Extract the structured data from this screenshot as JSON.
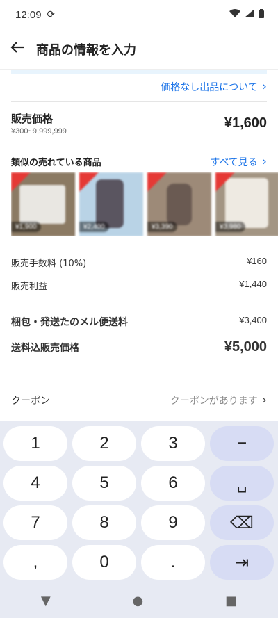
{
  "status": {
    "time": "12:09"
  },
  "header": {
    "title": "商品の情報を入力"
  },
  "links": {
    "no_price_listing": "価格なし出品について"
  },
  "price": {
    "label": "販売価格",
    "range": "¥300~9,999,999",
    "value": "¥1,600"
  },
  "similar": {
    "title": "類似の売れている商品",
    "see_all": "すべて見る",
    "items": [
      {
        "price": "¥1,900"
      },
      {
        "price": "¥2,400"
      },
      {
        "price": "¥3,390"
      },
      {
        "price": "¥3,980"
      }
    ]
  },
  "fees": {
    "commission_label": "販売手数料 (10%)",
    "commission_value": "¥160",
    "profit_label": "販売利益",
    "profit_value": "¥1,440",
    "shipping_label": "梱包・発送たのメル便送料",
    "shipping_value": "¥3,400",
    "total_label": "送料込販売価格",
    "total_value": "¥5,000"
  },
  "coupon": {
    "label": "クーポン",
    "hint": "クーポンがあります"
  },
  "keyboard": {
    "keys": [
      "1",
      "2",
      "3",
      "−",
      "4",
      "5",
      "6",
      "␣",
      "7",
      "8",
      "9",
      "⌫",
      ",",
      "0",
      ".",
      "⇥"
    ]
  },
  "colors": {
    "link": "#1a73e8",
    "keyboard_bg": "#e7eaf3",
    "fn_key": "#d7dcf4"
  }
}
